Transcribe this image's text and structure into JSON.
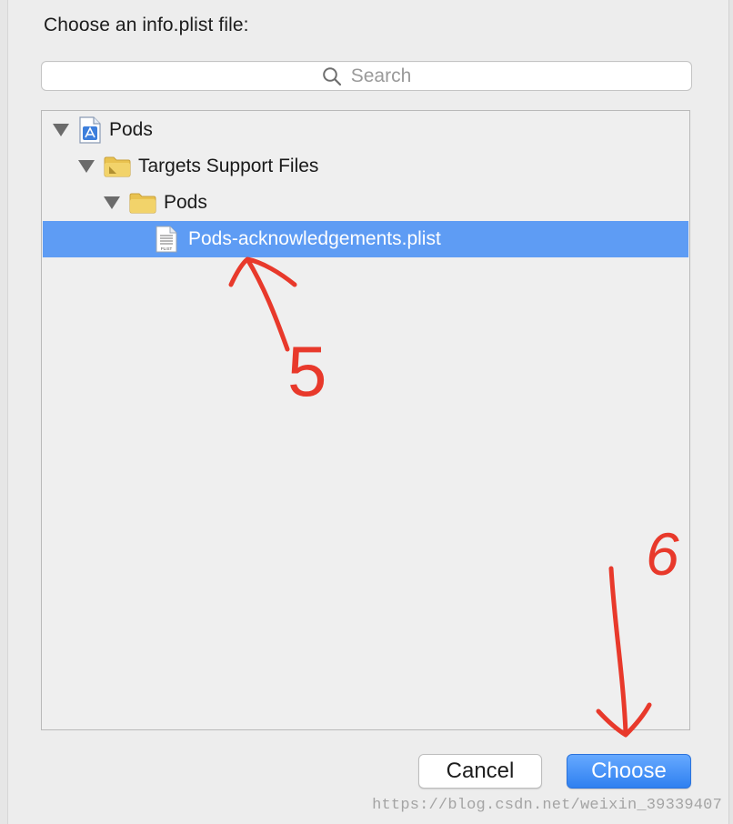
{
  "dialog": {
    "prompt": "Choose an info.plist file:"
  },
  "search": {
    "placeholder": "Search",
    "icon": "magnifier-icon"
  },
  "tree": {
    "items": [
      {
        "label": "Pods",
        "depth": 0,
        "expanded": true,
        "icon": "xcode-project-icon",
        "selected": false
      },
      {
        "label": "Targets Support Files",
        "depth": 1,
        "expanded": true,
        "icon": "folder-icon",
        "selected": false
      },
      {
        "label": "Pods",
        "depth": 2,
        "expanded": true,
        "icon": "folder-icon",
        "selected": false
      },
      {
        "label": "Pods-acknowledgements.plist",
        "depth": 3,
        "expanded": false,
        "icon": "plist-file-icon",
        "file_badge": "PLIST",
        "selected": true
      }
    ]
  },
  "buttons": {
    "cancel_label": "Cancel",
    "choose_label": "Choose"
  },
  "annotations": {
    "step_5": "5",
    "step_6": "6",
    "color": "#e8392b"
  },
  "watermark": "https://blog.csdn.net/weixin_39339407",
  "colors": {
    "selection": "#5e9cf4",
    "primary_button": "#3a8bf5",
    "folder": "#e9c24f"
  }
}
